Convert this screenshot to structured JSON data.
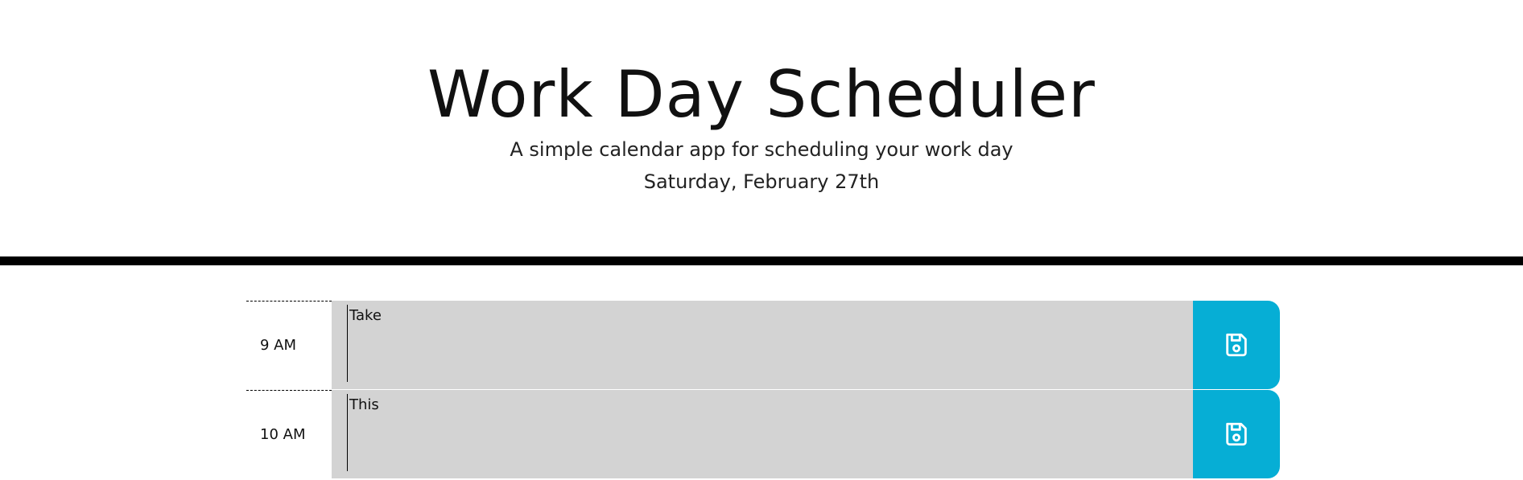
{
  "header": {
    "title": "Work Day Scheduler",
    "subtitle": "A simple calendar app for scheduling your work day",
    "current_date": "Saturday, February 27th"
  },
  "schedule": {
    "blocks": [
      {
        "hour": "9 AM",
        "description": "Take",
        "save_icon": "floppy-disk-icon"
      },
      {
        "hour": "10 AM",
        "description": "This",
        "save_icon": "floppy-disk-icon"
      }
    ]
  },
  "colors": {
    "save_button": "#06aed5",
    "description_background": "#d3d3d3",
    "header_rule": "#000000"
  }
}
